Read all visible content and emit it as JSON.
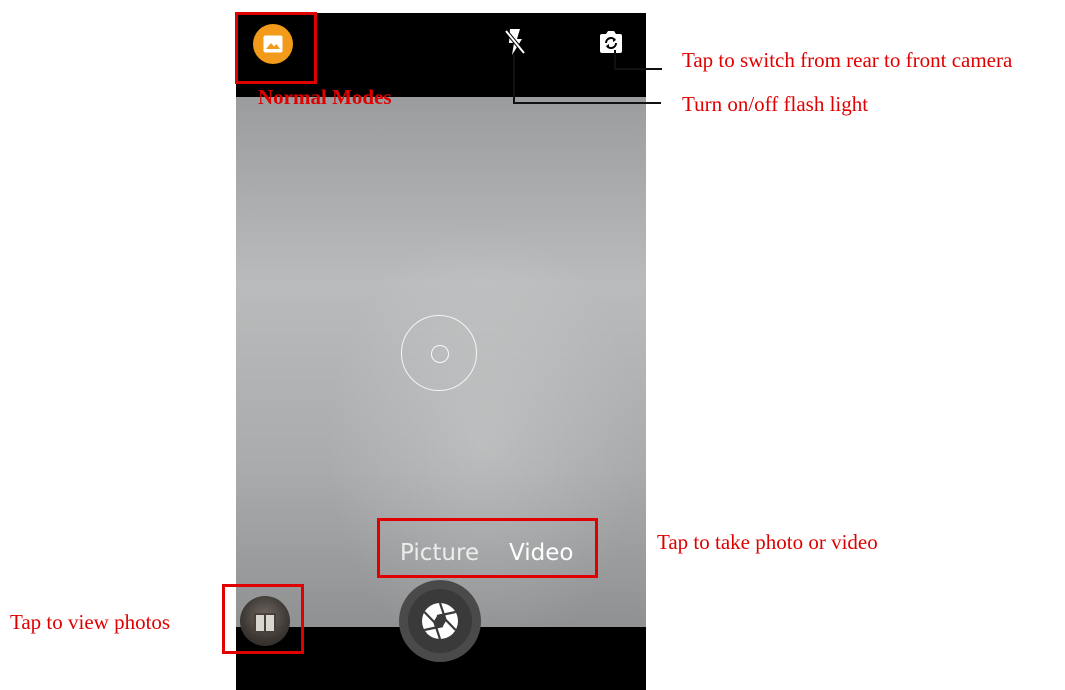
{
  "camera": {
    "modes": {
      "picture_label": "Picture",
      "video_label": "Video",
      "selected": "Video"
    },
    "icons": {
      "mode_button": "image-icon",
      "flash": "flash-off-icon",
      "switch_camera": "camera-switch-icon",
      "shutter": "aperture-icon",
      "gallery": "gallery-thumbnail"
    },
    "colors": {
      "mode_button_accent": "#f29b1a",
      "annotation_red": "#e00000"
    }
  },
  "annotations": {
    "normal_modes": "Normal Modes",
    "switch_camera": "Tap to switch from rear to front camera",
    "flash": "Turn on/off flash light",
    "take_photo_video": "Tap to take photo or video",
    "view_photos": "Tap to view photos"
  }
}
